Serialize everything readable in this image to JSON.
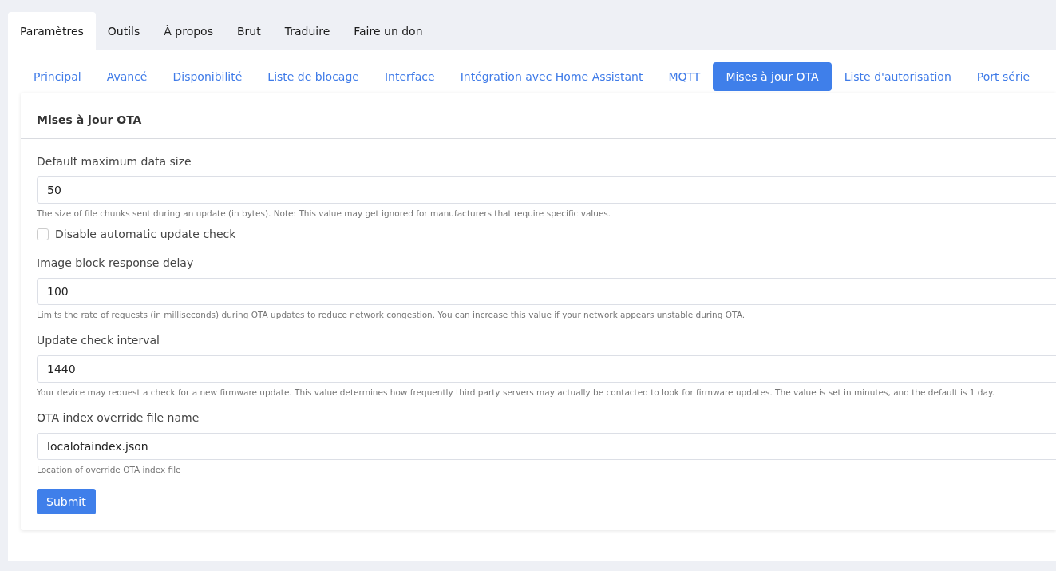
{
  "top_tabs": [
    {
      "label": "Paramètres",
      "selected": true
    },
    {
      "label": "Outils",
      "selected": false
    },
    {
      "label": "À propos",
      "selected": false
    },
    {
      "label": "Brut",
      "selected": false
    },
    {
      "label": "Traduire",
      "selected": false
    },
    {
      "label": "Faire un don",
      "selected": false
    }
  ],
  "sub_tabs": [
    {
      "label": "Principal",
      "selected": false
    },
    {
      "label": "Avancé",
      "selected": false
    },
    {
      "label": "Disponibilité",
      "selected": false
    },
    {
      "label": "Liste de blocage",
      "selected": false
    },
    {
      "label": "Interface",
      "selected": false
    },
    {
      "label": "Intégration avec Home Assistant",
      "selected": false
    },
    {
      "label": "MQTT",
      "selected": false
    },
    {
      "label": "Mises à jour OTA",
      "selected": true
    },
    {
      "label": "Liste d'autorisation",
      "selected": false
    },
    {
      "label": "Port série",
      "selected": false
    }
  ],
  "card": {
    "title": "Mises à jour OTA",
    "fields": [
      {
        "kind": "input",
        "label": "Default maximum data size",
        "value": "50",
        "help": "The size of file chunks sent during an update (in bytes). Note: This value may get ignored for manufacturers that require specific values."
      },
      {
        "kind": "checkbox",
        "label": "Disable automatic update check",
        "checked": false
      },
      {
        "kind": "input",
        "label": "Image block response delay",
        "value": "100",
        "help": "Limits the rate of requests (in milliseconds) during OTA updates to reduce network congestion. You can increase this value if your network appears unstable during OTA."
      },
      {
        "kind": "input",
        "label": "Update check interval",
        "value": "1440",
        "help": "Your device may request a check for a new firmware update. This value determines how frequently third party servers may actually be contacted to look for firmware updates. The value is set in minutes, and the default is 1 day."
      },
      {
        "kind": "input",
        "label": "OTA index override file name",
        "value": "localotaindex.json",
        "help": "Location of override OTA index file"
      }
    ],
    "submit": "Submit"
  }
}
